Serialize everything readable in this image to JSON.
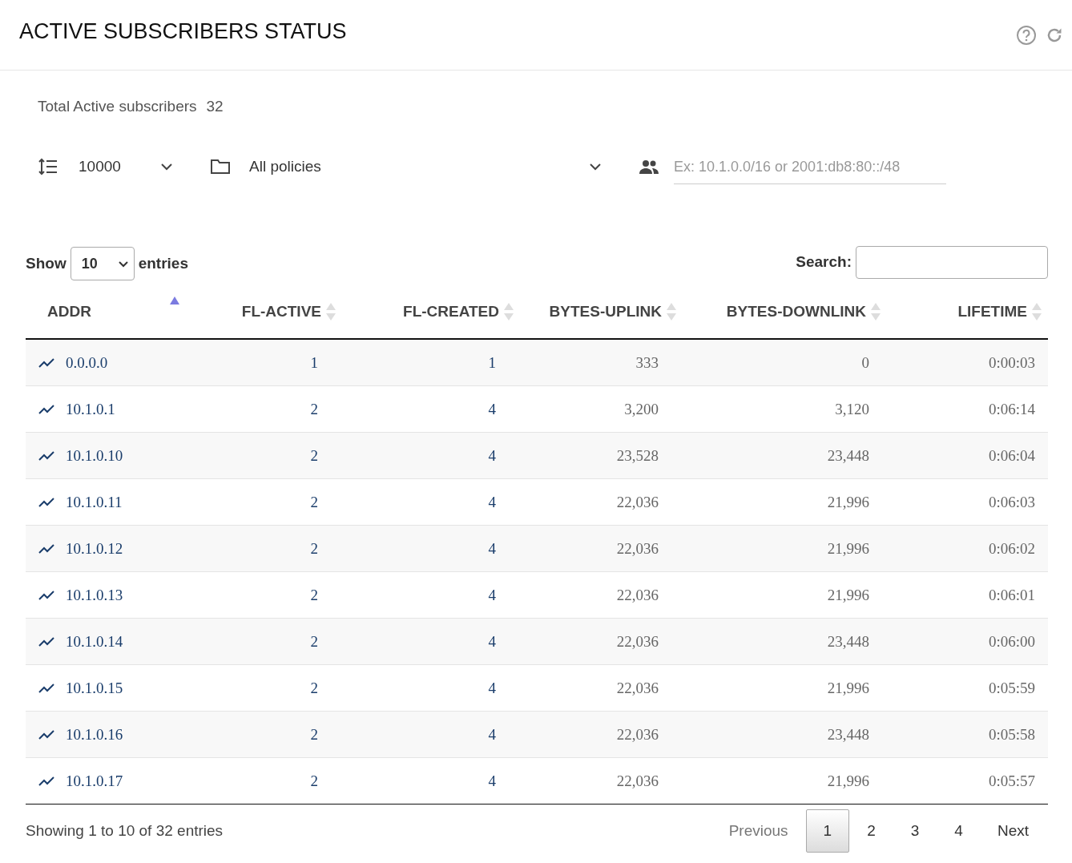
{
  "title": "ACTIVE SUBSCRIBERS STATUS",
  "total": {
    "label": "Total Active subscribers",
    "value": "32"
  },
  "filters": {
    "limit": "10000",
    "policy": "All policies",
    "ip_placeholder": "Ex: 10.1.0.0/16 or 2001:db8:80::/48"
  },
  "length": {
    "show": "Show",
    "value": "10",
    "entries": "entries"
  },
  "search": {
    "label": "Search:"
  },
  "columns": [
    {
      "label": "ADDR",
      "sorted": true
    },
    {
      "label": "FL-ACTIVE",
      "sorted": false
    },
    {
      "label": "FL-CREATED",
      "sorted": false
    },
    {
      "label": "BYTES-UPLINK",
      "sorted": false
    },
    {
      "label": "BYTES-DOWNLINK",
      "sorted": false
    },
    {
      "label": "LIFETIME",
      "sorted": false
    }
  ],
  "rows": [
    [
      "0.0.0.0",
      "1",
      "1",
      "333",
      "0",
      "0:00:03"
    ],
    [
      "10.1.0.1",
      "2",
      "4",
      "3,200",
      "3,120",
      "0:06:14"
    ],
    [
      "10.1.0.10",
      "2",
      "4",
      "23,528",
      "23,448",
      "0:06:04"
    ],
    [
      "10.1.0.11",
      "2",
      "4",
      "22,036",
      "21,996",
      "0:06:03"
    ],
    [
      "10.1.0.12",
      "2",
      "4",
      "22,036",
      "21,996",
      "0:06:02"
    ],
    [
      "10.1.0.13",
      "2",
      "4",
      "22,036",
      "21,996",
      "0:06:01"
    ],
    [
      "10.1.0.14",
      "2",
      "4",
      "22,036",
      "23,448",
      "0:06:00"
    ],
    [
      "10.1.0.15",
      "2",
      "4",
      "22,036",
      "21,996",
      "0:05:59"
    ],
    [
      "10.1.0.16",
      "2",
      "4",
      "22,036",
      "23,448",
      "0:05:58"
    ],
    [
      "10.1.0.17",
      "2",
      "4",
      "22,036",
      "21,996",
      "0:05:57"
    ]
  ],
  "info": "Showing 1 to 10 of 32 entries",
  "pagination": {
    "previous": "Previous",
    "next": "Next",
    "pages": [
      {
        "label": "1",
        "selected": true
      },
      {
        "label": "2",
        "selected": false
      },
      {
        "label": "3",
        "selected": false
      },
      {
        "label": "4",
        "selected": false
      }
    ]
  }
}
